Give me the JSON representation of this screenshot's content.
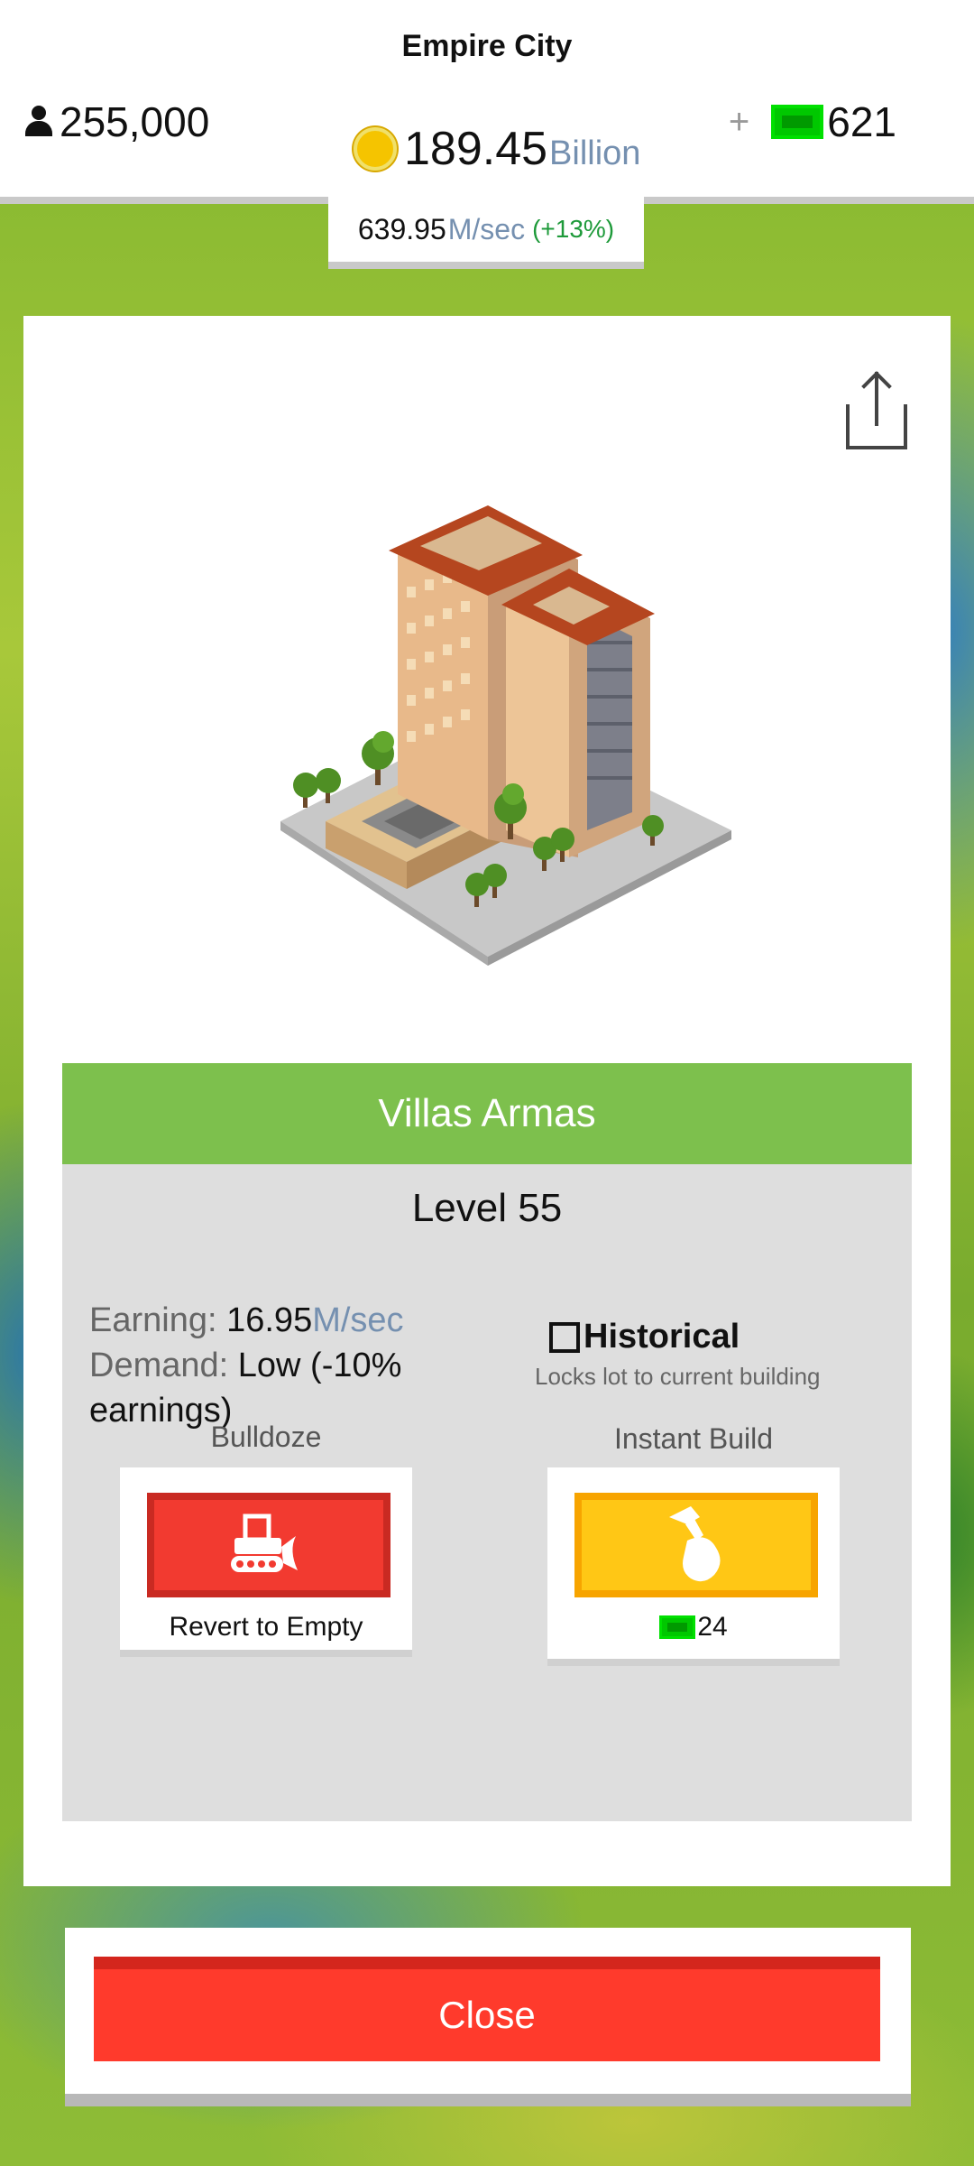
{
  "header": {
    "city_name": "Empire City",
    "population": "255,000",
    "money_value": "189.45",
    "money_unit": "Billion",
    "gems_plus": "+",
    "gems": "621",
    "rate_value": "639.95",
    "rate_unit": "M/sec",
    "rate_bonus": "(+13%)"
  },
  "building": {
    "name": "Villas Armas",
    "level": "Level 55",
    "earning_label": "Earning:",
    "earning_value": "16.95",
    "earning_unit": "M/sec",
    "demand_label": "Demand:",
    "demand_value": "Low (-10% earnings)",
    "historical_label": "Historical",
    "historical_checked": false,
    "historical_sub": "Locks lot to current building"
  },
  "actions": {
    "bulldoze_label": "Bulldoze",
    "bulldoze_caption": "Revert to Empty",
    "instant_label": "Instant Build",
    "instant_cost": "24"
  },
  "footer": {
    "close_label": "Close"
  },
  "colors": {
    "name_bar": "#7dc04d",
    "bulldoze": "#f23a30",
    "instant": "#ffc715",
    "close": "#ff3a2c",
    "gem": "#00c800"
  },
  "icons": [
    "person-icon",
    "coin-icon",
    "gem-icon",
    "share-icon",
    "bulldozer-icon",
    "hammer-icon"
  ]
}
